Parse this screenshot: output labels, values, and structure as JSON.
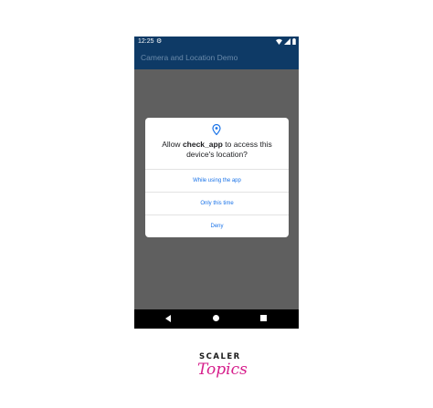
{
  "status_bar": {
    "time": "12:25",
    "settings_icon": "gear-icon",
    "wifi_icon": "wifi-icon",
    "signal_icon": "signal-icon",
    "battery_icon": "battery-icon"
  },
  "app_bar": {
    "title": "Camera and Location Demo"
  },
  "dialog": {
    "icon": "location-pin-icon",
    "title_prefix": "Allow ",
    "app_name": "check_app",
    "title_suffix": " to access this device's location?",
    "options": [
      "While using the app",
      "Only this time",
      "Deny"
    ]
  },
  "nav_bar": {
    "back_icon": "back-icon",
    "home_icon": "home-icon",
    "recents_icon": "recents-icon"
  },
  "brand": {
    "top": "SCALER",
    "bottom": "Topics"
  },
  "colors": {
    "app_bar": "#0e3a66",
    "scrim": "#5f5f5f",
    "accent": "#1a73e8",
    "brand_pink": "#d61f8c"
  }
}
